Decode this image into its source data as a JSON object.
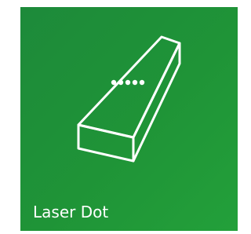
{
  "tile": {
    "label": "Laser Dot",
    "icon": "laser-bar-icon",
    "background_color": "#1f9437",
    "icon_color": "#ffffff"
  }
}
